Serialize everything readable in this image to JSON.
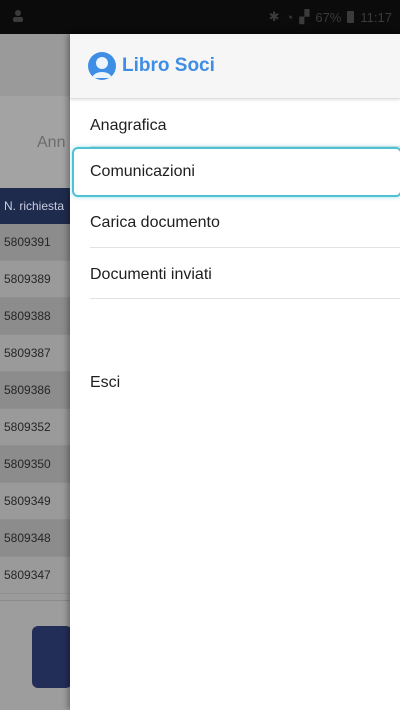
{
  "status_bar": {
    "battery": "67%",
    "time": "11:17"
  },
  "background_app": {
    "filter_label_fragment": "Ann",
    "table_header": "N. richiesta",
    "rows": [
      "5809391",
      "5809389",
      "5809388",
      "5809387",
      "5809386",
      "5809352",
      "5809350",
      "5809349",
      "5809348",
      "5809347"
    ]
  },
  "drawer": {
    "title": "Libro Soci",
    "items": [
      {
        "label": "Anagrafica"
      },
      {
        "label": "Comunicazioni"
      },
      {
        "label": "Carica documento"
      },
      {
        "label": "Documenti inviati"
      },
      {
        "label": "Esci"
      }
    ]
  },
  "colors": {
    "accent": "#3f8ee6",
    "focus_ring": "#4cc2d4",
    "header_navy": "#1f2b4d"
  }
}
